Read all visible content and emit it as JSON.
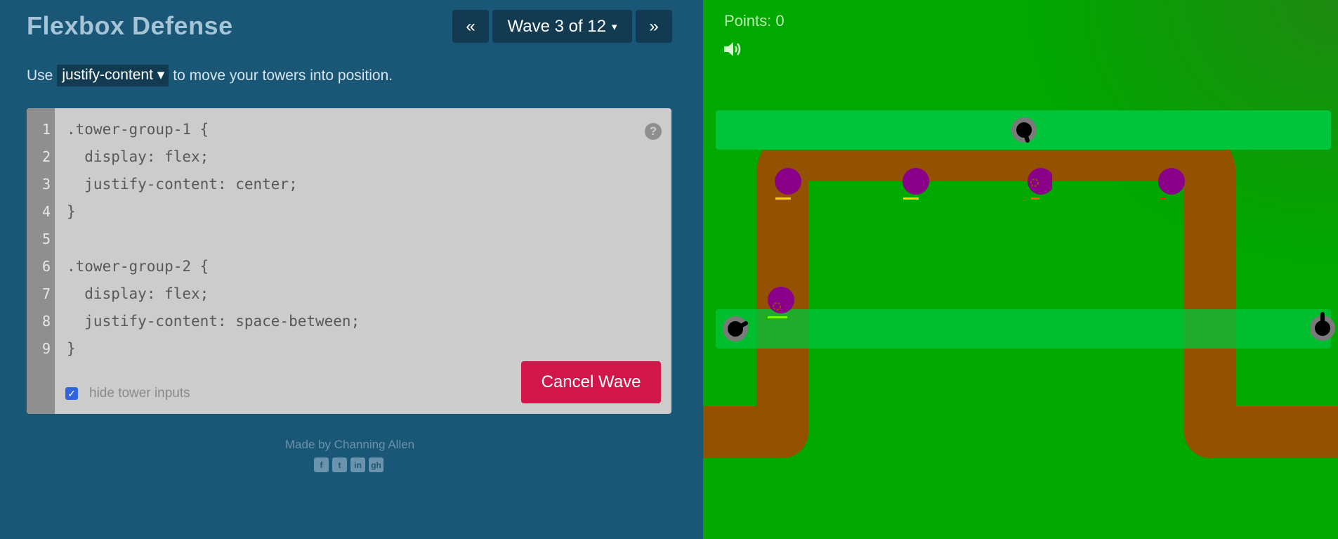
{
  "header": {
    "title": "Flexbox Defense",
    "prev_label": "«",
    "next_label": "»",
    "wave_label": "Wave 3 of 12",
    "wave_caret": "▾"
  },
  "instructions": {
    "prefix": "Use",
    "keyword": "justify-content ▾",
    "suffix": "to move your towers into position."
  },
  "editor": {
    "line_numbers": [
      "1",
      "2",
      "3",
      "4",
      "5",
      "6",
      "7",
      "8",
      "9"
    ],
    "lines": [
      ".tower-group-1 {",
      "  display: flex;",
      "  justify-content: center;",
      "}",
      "",
      ".tower-group-2 {",
      "  display: flex;",
      "  justify-content: space-between;",
      "}"
    ],
    "help_label": "?",
    "cancel_label": "Cancel Wave",
    "hide_inputs_label": "hide tower inputs",
    "hide_inputs_checked": true
  },
  "footer": {
    "credit": "Made by Channing Allen",
    "social_icons": [
      "facebook-icon",
      "twitter-icon",
      "linkedin-icon",
      "github-icon"
    ],
    "social_glyphs": [
      "f",
      "t",
      "in",
      "gh"
    ]
  },
  "game": {
    "points_label": "Points: 0",
    "sound_icon": "speaker-icon",
    "colors": {
      "grass": "#00a800",
      "track": "#00c43a",
      "path": "#945200",
      "enemy": "#8a0088",
      "tower_base": "#7a7a7a",
      "tower_gun": "#000000",
      "editor_bg": "#cccccc",
      "cancel_button": "#d1174a",
      "panel_bg": "#1a5675"
    },
    "tower_groups": [
      {
        "name": "tower-group-1",
        "justify_content": "center",
        "tower_count": 1
      },
      {
        "name": "tower-group-2",
        "justify_content": "space-between",
        "tower_count": 2
      }
    ],
    "enemy_count": 5,
    "enemy_health": [
      1.0,
      1.0,
      0.6,
      0.2,
      1.0
    ]
  }
}
